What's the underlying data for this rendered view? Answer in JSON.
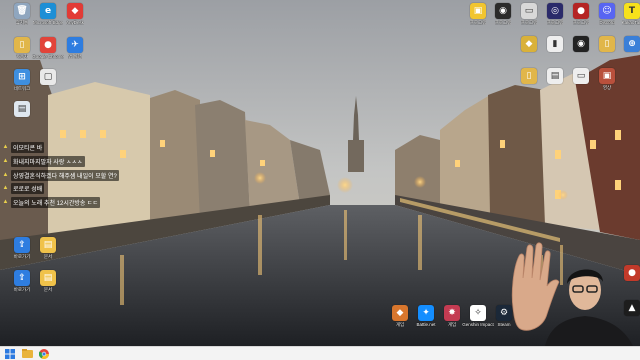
{
  "desktop": {
    "icons": [
      {
        "id": "recycle-bin",
        "label": "휴지통",
        "glyph": "🗑",
        "color": "#8fa6bf",
        "icon": "recycle-bin-icon"
      },
      {
        "id": "edge",
        "label": "Microsoft Edge",
        "glyph": "e",
        "color": "#1d8fd6",
        "icon": "edge-icon"
      },
      {
        "id": "anydesk",
        "label": "AnyDesk",
        "glyph": "◆",
        "color": "#e23b36",
        "icon": "anydesk-icon"
      },
      {
        "id": "user-folder",
        "label": "사용자",
        "glyph": "▯",
        "color": "#e1b64a",
        "icon": "user-folder-icon"
      },
      {
        "id": "chrome",
        "label": "Google Chrome",
        "glyph": "●",
        "color": "#e2443a",
        "icon": "chrome-icon"
      },
      {
        "id": "app-blue",
        "label": "앱 실행",
        "glyph": "✈",
        "color": "#2e7de0",
        "icon": "app-shortcut-icon"
      },
      {
        "id": "network",
        "label": "네트워크",
        "glyph": "⊞",
        "color": "#3e8fe0",
        "icon": "network-icon"
      },
      {
        "id": "file-1",
        "label": "",
        "glyph": "▢",
        "color": "#e9e9e9",
        "icon": "file-icon"
      },
      {
        "id": "file-2",
        "label": "",
        "glyph": "▤",
        "color": "#dfe7ef",
        "icon": "file-icon"
      },
      {
        "id": "shortcut-a",
        "label": "바로가기",
        "glyph": "⇪",
        "color": "#2e7de0",
        "icon": "shortcut-icon"
      },
      {
        "id": "doc-a",
        "label": "문서",
        "glyph": "▤",
        "color": "#f0c24a",
        "icon": "document-icon"
      },
      {
        "id": "shortcut-b",
        "label": "바로가기",
        "glyph": "⇪",
        "color": "#2e7de0",
        "icon": "shortcut-icon"
      },
      {
        "id": "doc-b",
        "label": "문서",
        "glyph": "▤",
        "color": "#f0c24a",
        "icon": "document-icon"
      },
      {
        "id": "tr-1",
        "label": "프로그램",
        "glyph": "▣",
        "color": "#f1c530",
        "icon": "app-icon"
      },
      {
        "id": "tr-2",
        "label": "프로그램",
        "glyph": "◉",
        "color": "#2b2b2b",
        "icon": "app-icon"
      },
      {
        "id": "tr-3",
        "label": "프로그램",
        "glyph": "▭",
        "color": "#d8d8d8",
        "icon": "app-icon"
      },
      {
        "id": "tr-4",
        "label": "프로그램",
        "glyph": "◎",
        "color": "#2a2a6a",
        "icon": "app-icon"
      },
      {
        "id": "tr-5",
        "label": "프로그램",
        "glyph": "●",
        "color": "#b52424",
        "icon": "app-icon"
      },
      {
        "id": "discord",
        "label": "Discord",
        "glyph": "☺",
        "color": "#5865f2",
        "icon": "discord-icon"
      },
      {
        "id": "kakaotalk",
        "label": "KakaoTalk",
        "glyph": "T",
        "color": "#f7e11b",
        "icon": "kakaotalk-icon"
      },
      {
        "id": "tr-6",
        "label": "",
        "glyph": "◆",
        "color": "#d9b13a",
        "icon": "app-icon"
      },
      {
        "id": "tr-7",
        "label": "",
        "glyph": "▮",
        "color": "#eeeeee",
        "icon": "app-icon"
      },
      {
        "id": "tr-8",
        "label": "",
        "glyph": "◉",
        "color": "#222222",
        "icon": "app-icon"
      },
      {
        "id": "tr-9",
        "label": "",
        "glyph": "▯",
        "color": "#e1b64a",
        "icon": "folder-icon"
      },
      {
        "id": "tr-10",
        "label": "",
        "glyph": "⊕",
        "color": "#3a7fd8",
        "icon": "app-icon"
      },
      {
        "id": "tr-11",
        "label": "",
        "glyph": "▯",
        "color": "#e1b64a",
        "icon": "folder-icon"
      },
      {
        "id": "tr-12",
        "label": "",
        "glyph": "▤",
        "color": "#eeeeee",
        "icon": "file-icon"
      },
      {
        "id": "tr-13",
        "label": "",
        "glyph": "▭",
        "color": "#eeeeee",
        "icon": "file-icon"
      },
      {
        "id": "tr-14",
        "label": "영상",
        "glyph": "▣",
        "color": "#b9503c",
        "icon": "image-icon"
      },
      {
        "id": "br-1",
        "label": "",
        "glyph": "●",
        "color": "#c23a2a",
        "icon": "app-icon"
      },
      {
        "id": "br-2",
        "label": "",
        "glyph": "▲",
        "color": "#1d1d1d",
        "icon": "app-icon"
      },
      {
        "id": "bm-1",
        "label": "게임",
        "glyph": "◆",
        "color": "#d8762d",
        "icon": "game-icon"
      },
      {
        "id": "bm-2",
        "label": "Battle.net",
        "glyph": "✦",
        "color": "#148eff",
        "icon": "battlenet-icon"
      },
      {
        "id": "bm-3",
        "label": "게임",
        "glyph": "✸",
        "color": "#c43b52",
        "icon": "game-icon"
      },
      {
        "id": "bm-4",
        "label": "Genshin Impact",
        "glyph": "✧",
        "color": "#ffffff",
        "icon": "game-icon"
      },
      {
        "id": "bm-5",
        "label": "Steam",
        "glyph": "⚙",
        "color": "#1b2838",
        "icon": "steam-icon"
      },
      {
        "id": "bm-6",
        "label": "Valorant",
        "glyph": "V",
        "color": "#ff4655",
        "icon": "valorant-icon"
      }
    ]
  },
  "chat": {
    "messages": [
      {
        "name": "",
        "text": "이모티콘 바",
        "name_color": "#ff9ad2"
      },
      {
        "name": "",
        "text": "화내지마지말자 사랑 ㅅㅅㅅ",
        "name_color": "#ff80c8"
      },
      {
        "name": "",
        "text": "상영결혼식하겠다 해주셈 내일이 모할 연?",
        "name_color": "#ff7fb4"
      },
      {
        "name": "",
        "text": "로로로 성배",
        "name_color": "#ff9ad2"
      },
      {
        "name": "",
        "text": "오늘의 노래 추천 12시간방송 ㄷㄷ",
        "name_color": "#ff5a5a"
      }
    ]
  },
  "taskbar": {
    "items": [
      {
        "id": "start",
        "icon": "windows-start-icon",
        "glyph": "⊞",
        "color": "#2b7ae0"
      },
      {
        "id": "explorer",
        "icon": "file-explorer-icon",
        "glyph": "▰",
        "color": "#e9b43b"
      },
      {
        "id": "chrome",
        "icon": "chrome-icon",
        "glyph": "●",
        "color": "#e2443a"
      }
    ]
  }
}
